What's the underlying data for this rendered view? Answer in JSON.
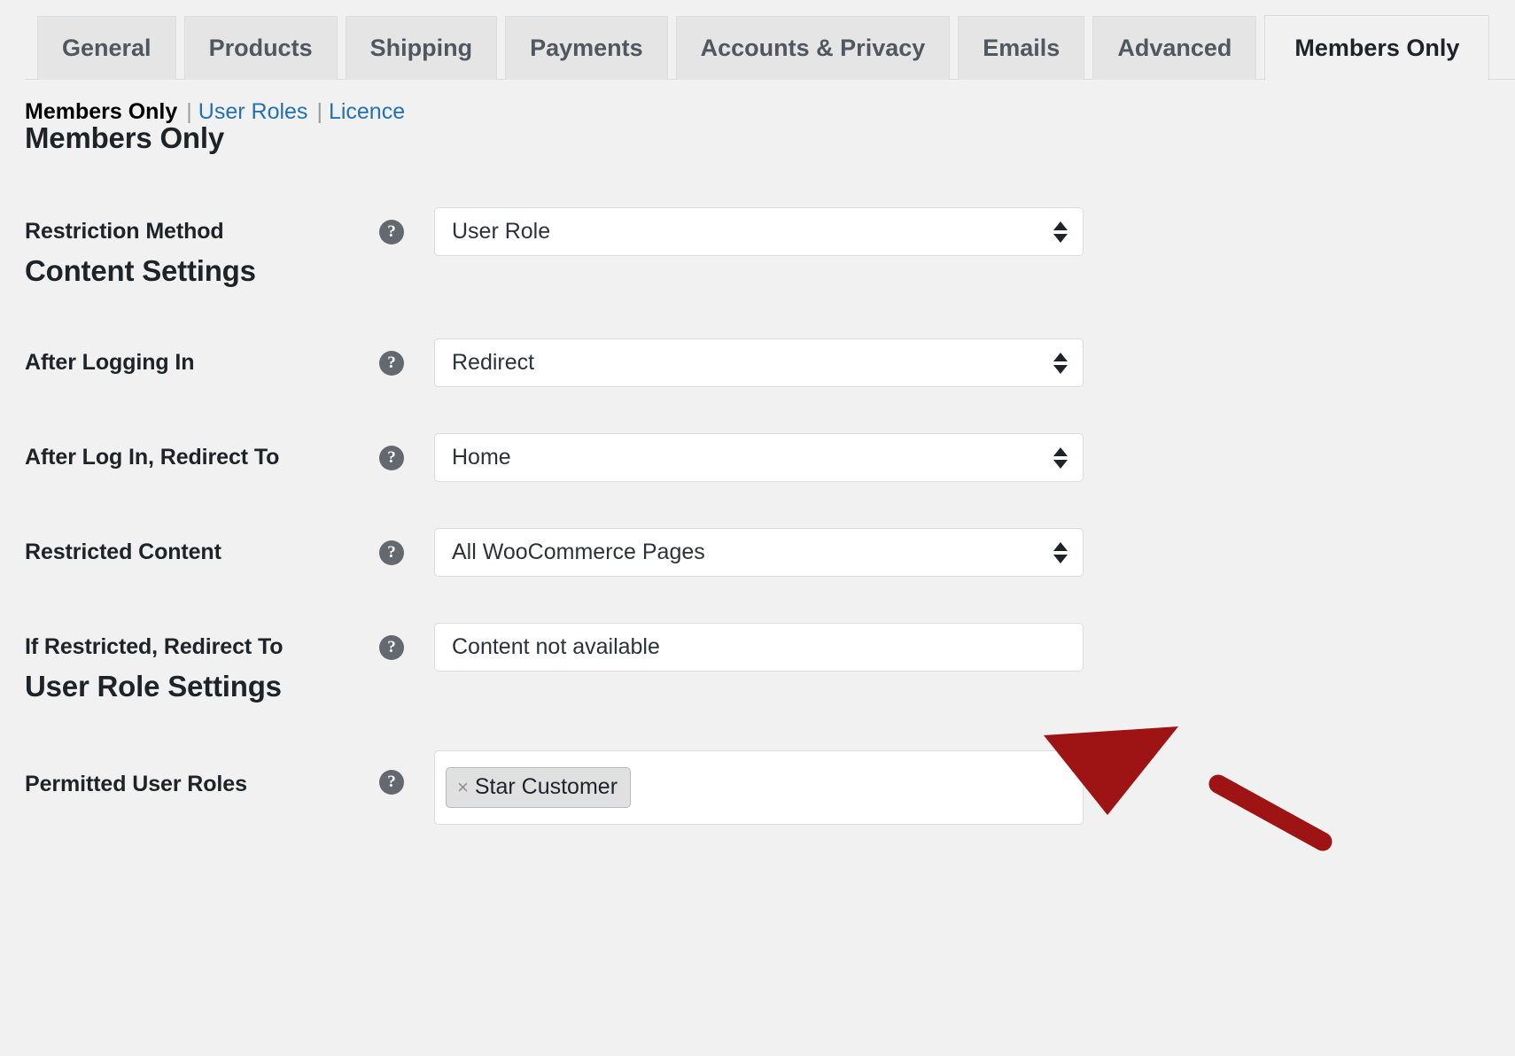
{
  "tabs": [
    {
      "label": "General",
      "active": false
    },
    {
      "label": "Products",
      "active": false
    },
    {
      "label": "Shipping",
      "active": false
    },
    {
      "label": "Payments",
      "active": false
    },
    {
      "label": "Accounts & Privacy",
      "active": false
    },
    {
      "label": "Emails",
      "active": false
    },
    {
      "label": "Advanced",
      "active": false
    },
    {
      "label": "Members Only",
      "active": true
    }
  ],
  "subnav": {
    "current": "Members Only",
    "separator": "|",
    "links": [
      {
        "label": "User Roles"
      },
      {
        "label": "Licence"
      }
    ]
  },
  "sections": {
    "members_only": "Members Only",
    "content_settings": "Content Settings",
    "user_role_settings": "User Role Settings"
  },
  "help_glyph": "?",
  "fields": {
    "restriction_method": {
      "label": "Restriction Method",
      "value": "User Role",
      "type": "select"
    },
    "after_logging_in": {
      "label": "After Logging In",
      "value": "Redirect",
      "type": "select"
    },
    "after_log_in_redirect_to": {
      "label": "After Log In, Redirect To",
      "value": "Home",
      "type": "select"
    },
    "restricted_content": {
      "label": "Restricted Content",
      "value": "All WooCommerce Pages",
      "type": "select"
    },
    "if_restricted_redirect_to": {
      "label": "If Restricted, Redirect To",
      "value": "Content not available",
      "type": "select"
    },
    "permitted_user_roles": {
      "label": "Permitted User Roles",
      "type": "multiselect",
      "remove_glyph": "×",
      "tokens": [
        {
          "label": "Star Customer"
        }
      ]
    }
  },
  "annotation": {
    "type": "arrow",
    "color": "#9e1414",
    "points_to": "if_restricted_redirect_to"
  },
  "colors": {
    "page_background": "#f1f1f1",
    "tab_inactive": "#e5e5e5",
    "tab_active": "#f1f1f1",
    "link": "#2271b1",
    "text": "#1d2327",
    "field_background": "#ffffff",
    "field_border": "#dcdcde",
    "help_icon": "#646970",
    "annotation_red": "#9e1414"
  }
}
